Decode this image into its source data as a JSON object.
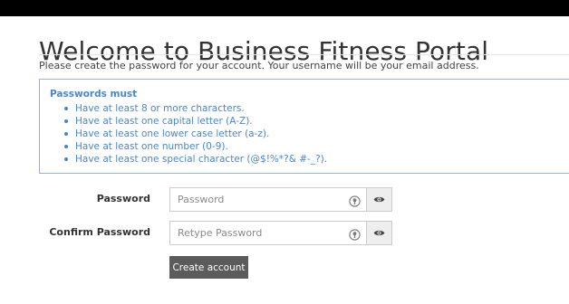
{
  "page": {
    "title": "Welcome to Business Fitness Portal",
    "intro": "Please create the password for your account. Your username will be your email address."
  },
  "requirements": {
    "title": "Passwords must",
    "items": [
      "Have at least 8 or more characters.",
      "Have at least one capital letter (A-Z).",
      "Have at least one lower case letter (a-z).",
      "Have at least one number (0-9).",
      "Have at least one special character (@$!%*?& #-_?)."
    ]
  },
  "form": {
    "password": {
      "label": "Password",
      "placeholder": "Password",
      "value": ""
    },
    "confirm_password": {
      "label": "Confirm Password",
      "placeholder": "Retype Password",
      "value": ""
    },
    "submit_label": "Create account"
  },
  "icons": {
    "field_icon": "password-manager-icon",
    "toggle_icon": "eye-icon"
  },
  "colors": {
    "accent": "#4a86cf",
    "box_border": "#8fb4e3",
    "button": "#5b5b5b",
    "top_bar": "#000000"
  }
}
